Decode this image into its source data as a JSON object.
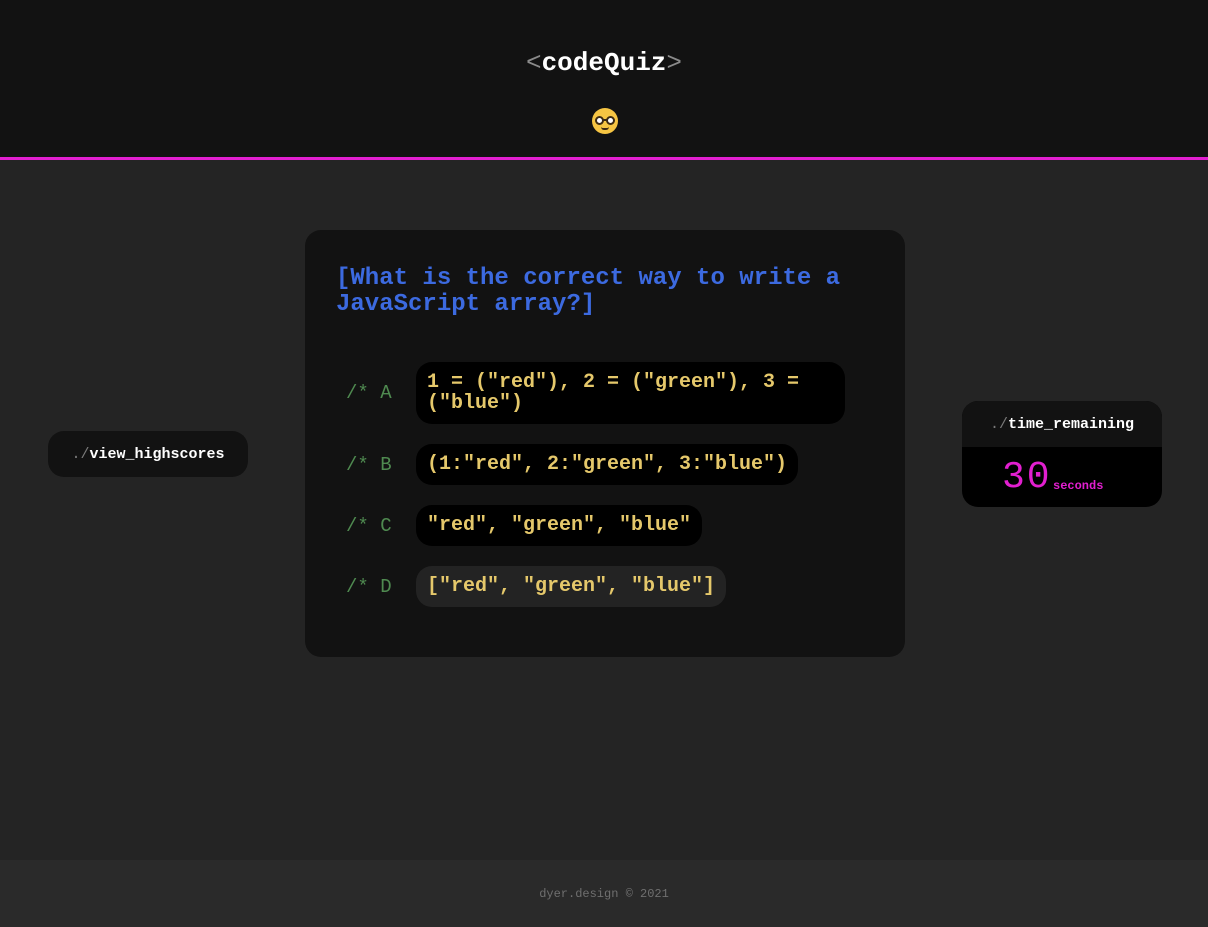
{
  "header": {
    "logo_open": "<",
    "logo_text": "codeQuiz",
    "logo_close": ">",
    "emoji": "nerd-face"
  },
  "nav": {
    "highscores_prefix": "./",
    "highscores_label": "view_highscores"
  },
  "quiz": {
    "question": "[What is the correct way to write a JavaScript array?]",
    "options": [
      {
        "label": "/* A",
        "text": "1 = (\"red\"), 2 = (\"green\"), 3 = (\"blue\")"
      },
      {
        "label": "/* B",
        "text": "(1:\"red\", 2:\"green\", 3:\"blue\")"
      },
      {
        "label": "/* C",
        "text": "\"red\", \"green\", \"blue\""
      },
      {
        "label": "/* D",
        "text": "[\"red\", \"green\", \"blue\"]"
      }
    ]
  },
  "timer": {
    "prefix": "./",
    "title": "time_remaining",
    "value": "30",
    "unit": "seconds"
  },
  "footer": {
    "text": "dyer.design © 2021"
  },
  "colors": {
    "accent": "#e21fd0",
    "question": "#3c6ae0",
    "option_text": "#e5c86b",
    "option_label": "#4f8a50"
  }
}
